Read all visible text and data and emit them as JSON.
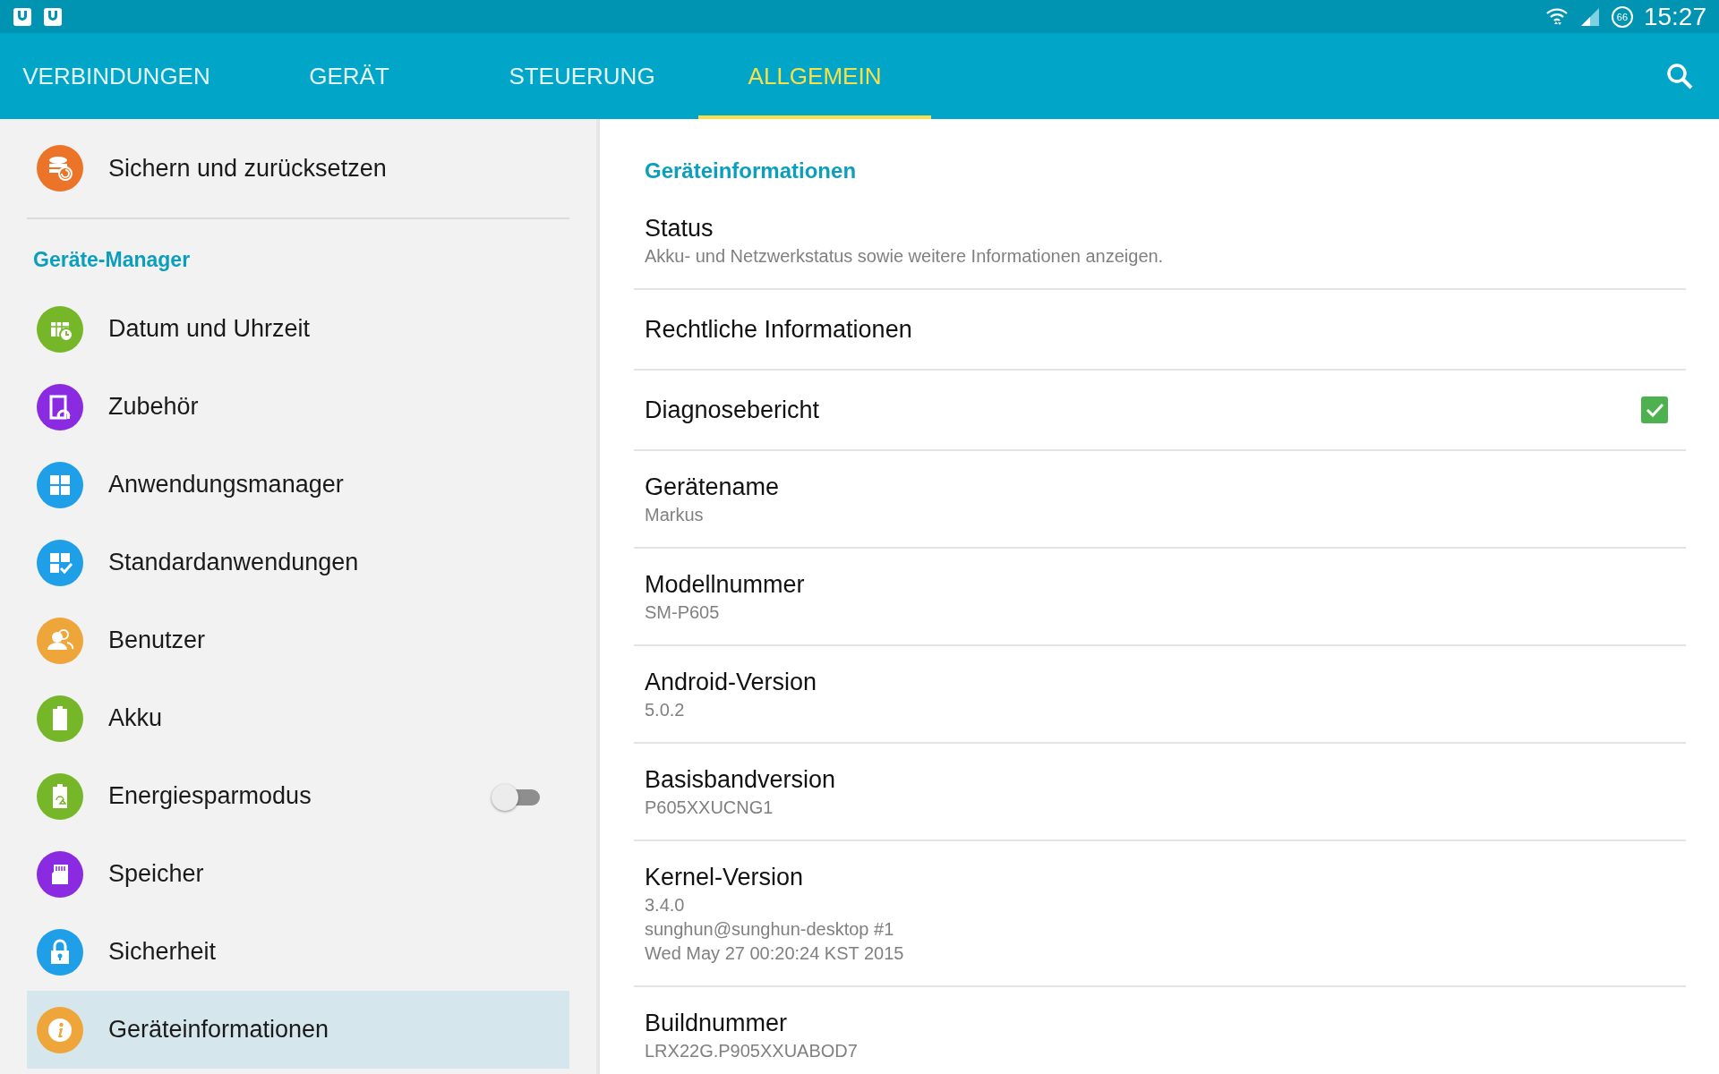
{
  "status_bar": {
    "battery": "66",
    "time": "15:27"
  },
  "tabs": [
    {
      "label": "VERBINDUNGEN",
      "selected": false
    },
    {
      "label": "GERÄT",
      "selected": false
    },
    {
      "label": "STEUERUNG",
      "selected": false
    },
    {
      "label": "ALLGEMEIN",
      "selected": true
    }
  ],
  "sidebar": {
    "top_item": {
      "label": "Sichern und zurücksetzen",
      "color": "#ec7428"
    },
    "section_title": "Geräte-Manager",
    "items": [
      {
        "label": "Datum und Uhrzeit",
        "color": "#76b72a",
        "kind": "link",
        "selected": false
      },
      {
        "label": "Zubehör",
        "color": "#8a2be2",
        "kind": "link",
        "selected": false
      },
      {
        "label": "Anwendungsmanager",
        "color": "#1e9fe8",
        "kind": "link",
        "selected": false
      },
      {
        "label": "Standardanwendungen",
        "color": "#1e9fe8",
        "kind": "link",
        "selected": false
      },
      {
        "label": "Benutzer",
        "color": "#eea53a",
        "kind": "link",
        "selected": false
      },
      {
        "label": "Akku",
        "color": "#76b72a",
        "kind": "link",
        "selected": false
      },
      {
        "label": "Energiesparmodus",
        "color": "#76b72a",
        "kind": "toggle",
        "on": false,
        "selected": false
      },
      {
        "label": "Speicher",
        "color": "#8a2be2",
        "kind": "link",
        "selected": false
      },
      {
        "label": "Sicherheit",
        "color": "#1e9fe8",
        "kind": "link",
        "selected": false
      },
      {
        "label": "Geräteinformationen",
        "color": "#eea53a",
        "kind": "link",
        "selected": true
      }
    ]
  },
  "details": {
    "title": "Geräteinformationen",
    "rows": [
      {
        "kind": "text",
        "title": "Status",
        "summary": [
          "Akku- und Netzwerkstatus sowie weitere Informationen anzeigen."
        ]
      },
      {
        "kind": "text",
        "title": "Rechtliche Informationen"
      },
      {
        "kind": "checkbox",
        "title": "Diagnosebericht",
        "checked": true
      },
      {
        "kind": "text",
        "title": "Gerätename",
        "summary": [
          "Markus"
        ]
      },
      {
        "kind": "text",
        "title": "Modellnummer",
        "summary": [
          "SM-P605"
        ]
      },
      {
        "kind": "text",
        "title": "Android-Version",
        "summary": [
          "5.0.2"
        ]
      },
      {
        "kind": "text",
        "title": "Basisbandversion",
        "summary": [
          "P605XXUCNG1"
        ]
      },
      {
        "kind": "text",
        "title": "Kernel-Version",
        "summary": [
          "3.4.0",
          "sunghun@sunghun-desktop #1",
          "Wed May 27 00:20:24 KST 2015"
        ]
      },
      {
        "kind": "text",
        "title": "Buildnummer",
        "summary": [
          "LRX22G.P905XXUABOD7"
        ]
      }
    ]
  }
}
